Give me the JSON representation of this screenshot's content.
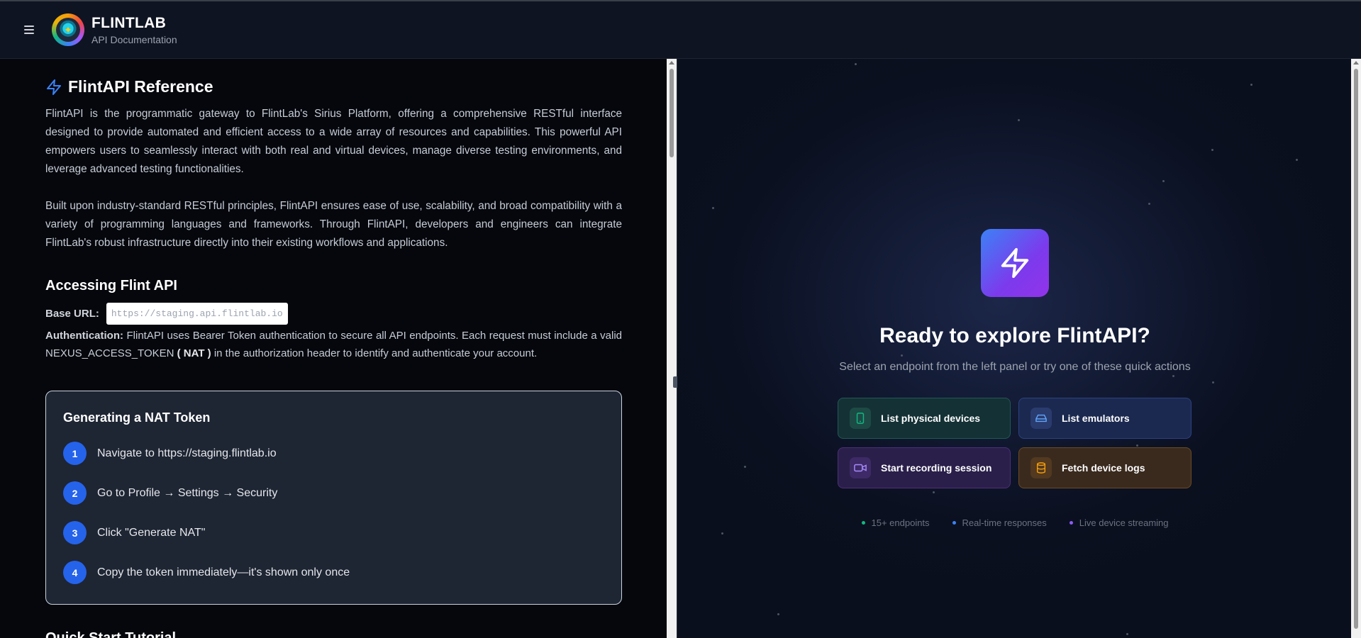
{
  "header": {
    "brand_name": "FLINTLAB",
    "brand_subtitle": "API Documentation"
  },
  "doc": {
    "title": "FlintAPI Reference",
    "intro_p1": "FlintAPI is the programmatic gateway to FlintLab's Sirius Platform, offering a comprehensive RESTful interface designed to provide automated and efficient access to a wide array of resources and capabilities. This powerful API empowers users to seamlessly interact with both real and virtual devices, manage diverse testing environments, and leverage advanced testing functionalities.",
    "intro_p2": "Built upon industry-standard RESTful principles, FlintAPI ensures ease of use, scalability, and broad compatibility with a variety of programming languages and frameworks. Through FlintAPI, developers and engineers can integrate FlintLab's robust infrastructure directly into their existing workflows and applications.",
    "access_heading": "Accessing Flint API",
    "base_url_label": "Base URL:",
    "base_url": "https://staging.api.flintlab.io",
    "auth_label": "Authentication:",
    "auth_text_1": "FlintAPI uses Bearer Token authentication to secure all API endpoints. Each request must include a valid NEXUS_ACCESS_TOKEN",
    "auth_nat": "( NAT )",
    "auth_text_2": "in the authorization header to identify and authenticate your account.",
    "token_card": {
      "title": "Generating a NAT Token",
      "steps": [
        {
          "num": "1",
          "text": "Navigate to https://staging.flintlab.io"
        },
        {
          "num": "2",
          "text": "Go to Profile → Settings → Security"
        },
        {
          "num": "3",
          "text": "Click \"Generate NAT\""
        },
        {
          "num": "4",
          "text": "Copy the token immediately—it's shown only once"
        }
      ]
    },
    "quick_start_heading": "Quick Start Tutorial"
  },
  "explorer": {
    "title": "Ready to explore FlintAPI?",
    "subtitle": "Select an endpoint from the left panel or try one of these quick actions",
    "actions": [
      {
        "label": "List physical devices",
        "icon": "phone-icon",
        "color": "#10b981"
      },
      {
        "label": "List emulators",
        "icon": "hard-drive-icon",
        "color": "#60a5fa"
      },
      {
        "label": "Start recording session",
        "icon": "video-icon",
        "color": "#a78bfa"
      },
      {
        "label": "Fetch device logs",
        "icon": "database-icon",
        "color": "#f59e0b"
      }
    ],
    "features": [
      {
        "label": "15+ endpoints",
        "color": "#10b981"
      },
      {
        "label": "Real-time responses",
        "color": "#3b82f6"
      },
      {
        "label": "Live device streaming",
        "color": "#8b5cf6"
      }
    ]
  },
  "colors": {
    "accent": "#2563eb",
    "hero_gradient_start": "#3b82f6",
    "hero_gradient_end": "#9333ea"
  }
}
